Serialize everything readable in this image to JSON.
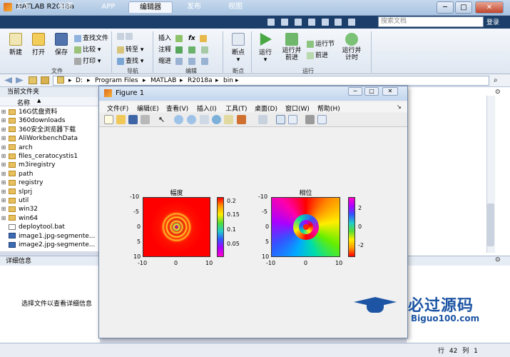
{
  "app": {
    "title": "MATLAB R2018a",
    "window_controls": [
      "─",
      "□",
      "✕"
    ]
  },
  "tabs": [
    "主页",
    "绘图",
    "APP",
    "编辑器",
    "发布",
    "视图"
  ],
  "active_tab": "编辑器",
  "search": {
    "placeholder": "搜索文档"
  },
  "login_label": "登录",
  "ribbon": {
    "file_group": {
      "label": "文件",
      "new": "新建",
      "open": "打开",
      "save": "保存",
      "find_files": "查找文件",
      "compare": "比较",
      "print": "打印"
    },
    "nav_group": {
      "label": "导航",
      "goto": "转至",
      "find": "查找"
    },
    "edit_group": {
      "label": "编辑",
      "insert": "插入",
      "comment": "注释",
      "indent": "缩进",
      "fx": "fx"
    },
    "breakpoint_group": {
      "label": "断点",
      "breakpoints": "断点"
    },
    "run_group": {
      "label": "运行",
      "run": "运行",
      "run_advance": "运行并前进",
      "run_section": "运行节",
      "advance": "前进",
      "run_time": "运行并计时"
    }
  },
  "path": [
    "D:",
    "Program Files",
    "MATLAB",
    "R2018a",
    "bin"
  ],
  "current_folder": {
    "header": "当前文件夹",
    "column": "名称",
    "sort_indicator": "▲",
    "items": [
      {
        "name": "16G优盘资料",
        "kind": "folder"
      },
      {
        "name": "360downloads",
        "kind": "folder"
      },
      {
        "name": "360安全浏览器下载",
        "kind": "folder"
      },
      {
        "name": "AliWorkbenchData",
        "kind": "folder"
      },
      {
        "name": "arch",
        "kind": "folder"
      },
      {
        "name": "files_ceratocystis1",
        "kind": "folder"
      },
      {
        "name": "m3iregistry",
        "kind": "folder"
      },
      {
        "name": "path",
        "kind": "folder"
      },
      {
        "name": "registry",
        "kind": "folder"
      },
      {
        "name": "slprj",
        "kind": "folder"
      },
      {
        "name": "util",
        "kind": "folder"
      },
      {
        "name": "win32",
        "kind": "folder"
      },
      {
        "name": "win64",
        "kind": "folder"
      },
      {
        "name": "deploytool.bat",
        "kind": "file"
      },
      {
        "name": "image1.jpg-segmente...",
        "kind": "image"
      },
      {
        "name": "image2.jpg-segmente...",
        "kind": "image"
      }
    ]
  },
  "details": {
    "header": "详细信息",
    "text": "选择文件以查看详细信息"
  },
  "status": {
    "row_label": "行",
    "row": "42",
    "col_label": "列",
    "col": "1"
  },
  "figure": {
    "title": "Figure 1",
    "menu": [
      "文件(F)",
      "编辑(E)",
      "查看(V)",
      "插入(I)",
      "工具(T)",
      "桌面(D)",
      "窗口(W)",
      "帮助(H)"
    ],
    "plots": [
      {
        "title": "幅度",
        "xticks": [
          "-10",
          "0",
          "10"
        ],
        "yticks": [
          "-10",
          "-5",
          "0",
          "5",
          "10"
        ],
        "colorbar_ticks": [
          "0.2",
          "0.15",
          "0.1",
          "0.05"
        ]
      },
      {
        "title": "相位",
        "xticks": [
          "-10",
          "0",
          "10"
        ],
        "yticks": [
          "-10",
          "-5",
          "0",
          "5",
          "10"
        ],
        "colorbar_ticks": [
          "2",
          "0",
          "-2"
        ]
      }
    ]
  },
  "watermark": {
    "title": "必过源码",
    "subtitle": "Biguo100.com"
  }
}
